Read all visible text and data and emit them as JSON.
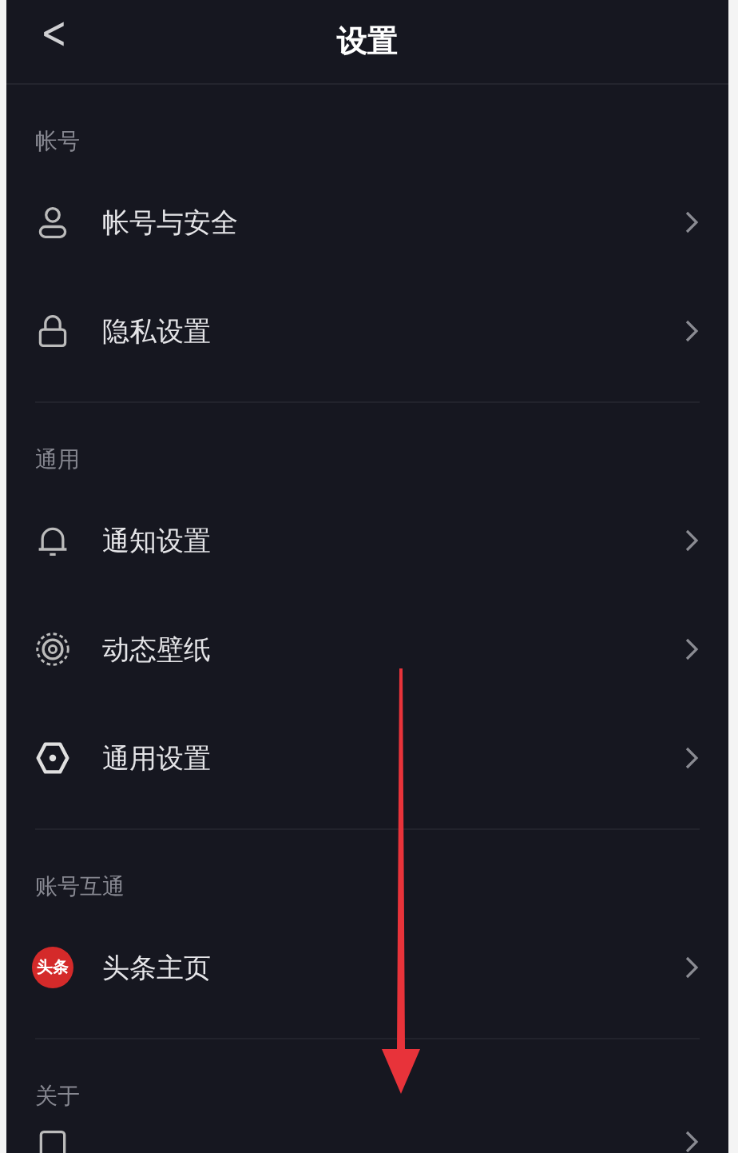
{
  "header": {
    "back": "<",
    "title": "设置"
  },
  "sections": [
    {
      "title": "帐号",
      "items": [
        {
          "label": "帐号与安全"
        },
        {
          "label": "隐私设置"
        }
      ]
    },
    {
      "title": "通用",
      "items": [
        {
          "label": "通知设置"
        },
        {
          "label": "动态壁纸"
        },
        {
          "label": "通用设置"
        }
      ]
    },
    {
      "title": "账号互通",
      "items": [
        {
          "badge": "头条",
          "label": "头条主页"
        }
      ]
    },
    {
      "title": "关于"
    }
  ]
}
